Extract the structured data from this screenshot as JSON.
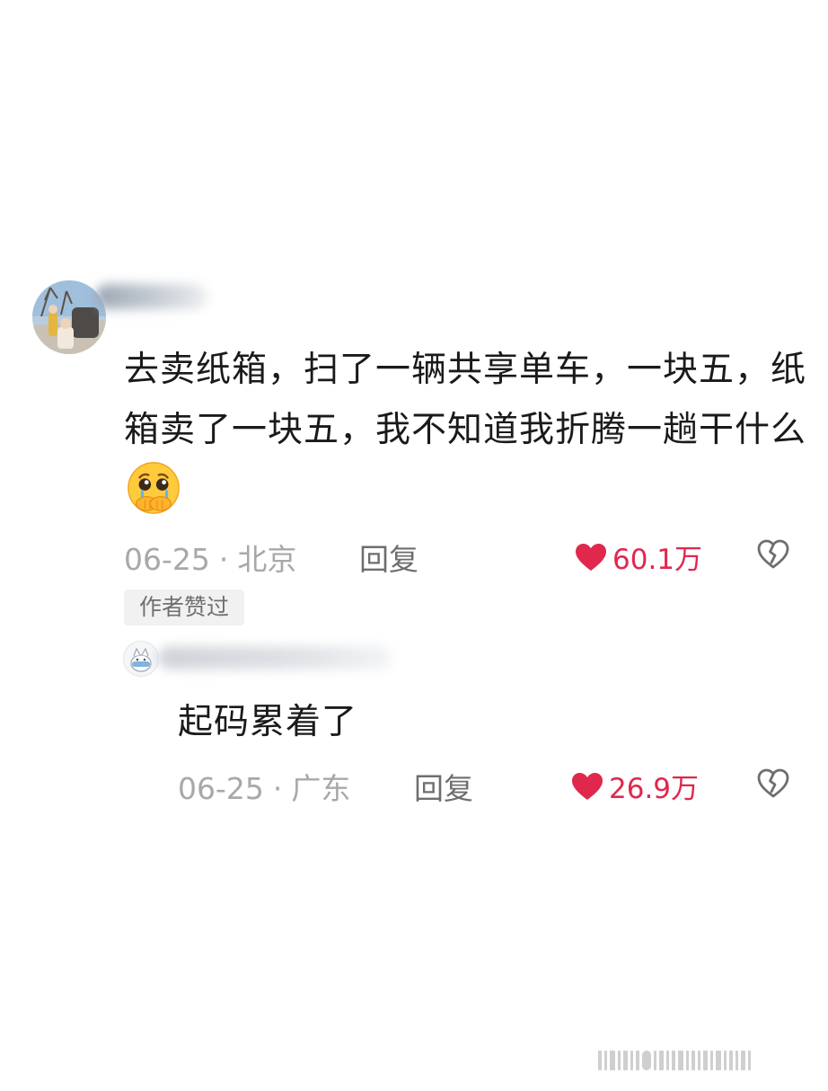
{
  "comment": {
    "text": "去卖纸箱，扫了一辆共享单车，一块五，纸箱卖了一块五，我不知道我折腾一趟干什么",
    "emoji_icon": "crying-face-hands-over-mouth-icon",
    "date": "06-25",
    "location": "北京",
    "reply_label": "回复",
    "likes": "60.1万",
    "author_badge": "作者赞过"
  },
  "reply": {
    "text": "起码累着了",
    "date": "06-25",
    "location": "广东",
    "reply_label": "回复",
    "likes": "26.9万"
  },
  "separator": "·",
  "colors": {
    "like": "#e0284d",
    "meta_text": "#a8a8a8",
    "badge_bg": "#f1f1f1"
  }
}
